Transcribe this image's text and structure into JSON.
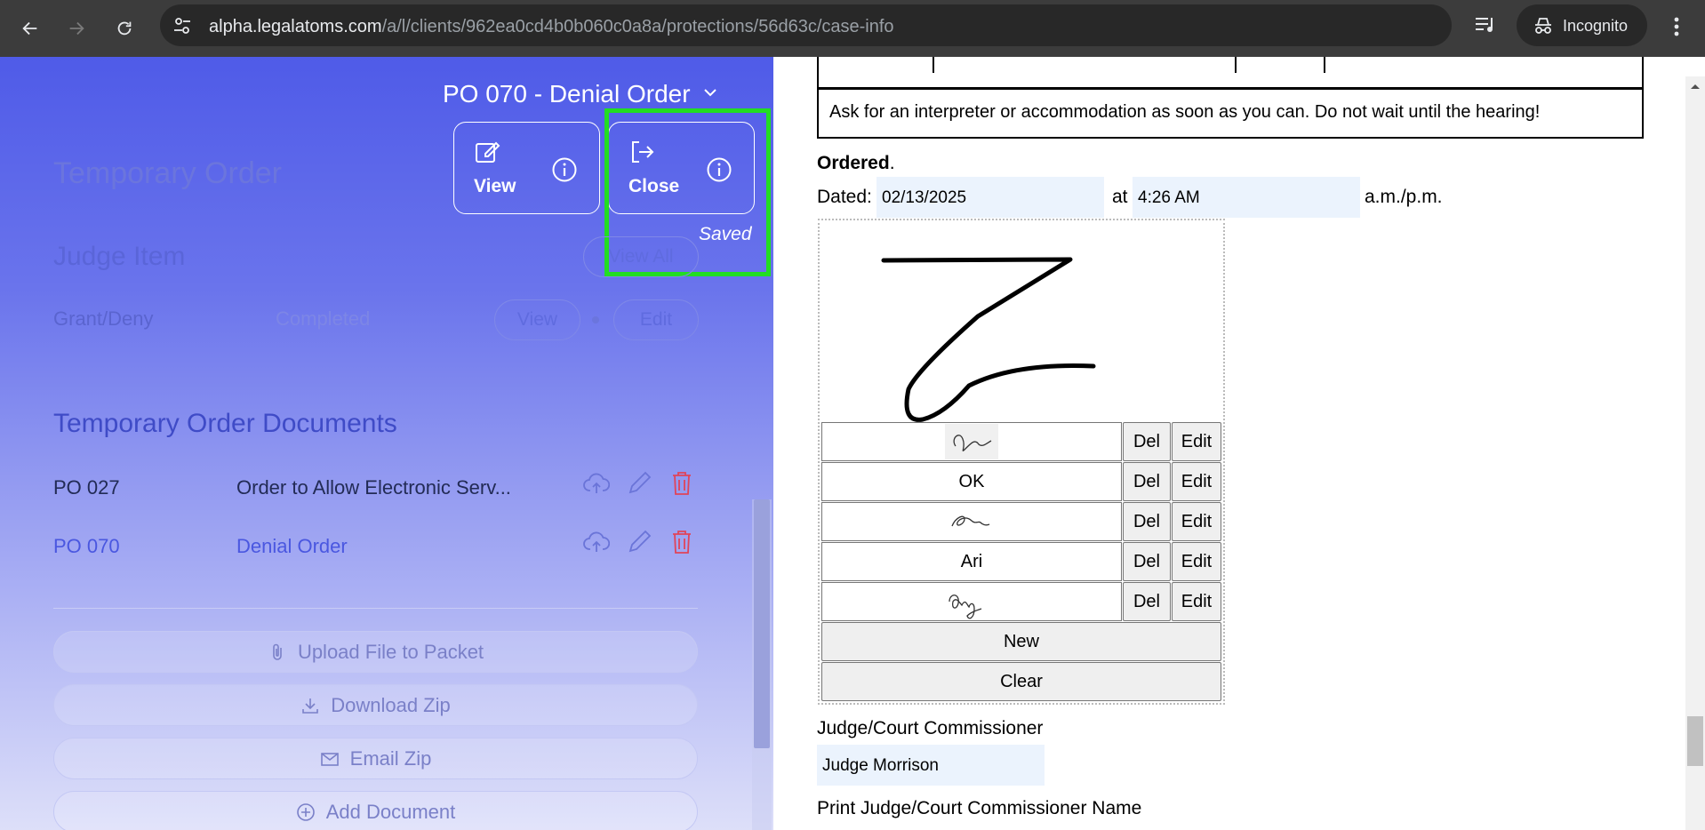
{
  "browser": {
    "url_host": "alpha.legalatoms.com",
    "url_path": "/a/l/clients/962ea0cd4b0b060c0a8a/protections/56d63c/case-info",
    "incognito_label": "Incognito"
  },
  "left_panel": {
    "background_title": "Temporary Order",
    "document_heading": "PO 070 - Denial Order",
    "actions": [
      {
        "label": "View",
        "icon": "edit-square-icon"
      },
      {
        "label": "Close",
        "icon": "exit-icon"
      }
    ],
    "saved_label": "Saved",
    "judge_section": {
      "title": "Judge Item",
      "view_all_label": "View All",
      "item_name": "Grant/Deny",
      "item_status": "Completed",
      "view_label": "View",
      "edit_label": "Edit"
    },
    "documents_section": {
      "title": "Temporary Order Documents",
      "rows": [
        {
          "code": "PO 027",
          "name": "Order to Allow Electronic Serv..."
        },
        {
          "code": "PO 070",
          "name": "Denial Order"
        }
      ]
    },
    "buttons": {
      "upload": "Upload File to Packet",
      "download": "Download Zip",
      "email": "Email Zip",
      "add": "Add Document"
    },
    "colors": {
      "accent": "#4f5be8",
      "highlight": "#22dd22",
      "delete": "#e0445a"
    }
  },
  "document": {
    "notice": "Ask for an interpreter or accommodation as soon as you can. Do not wait until the hearing!",
    "ordered_bold": "Ordered",
    "ordered_suffix": ".",
    "dated_label": "Dated:",
    "date_value": "02/13/2025",
    "at_label": "at",
    "time_value": "4:26 AM",
    "ampm_label": "a.m./p.m.",
    "signature_rows": [
      {
        "text": "",
        "kind": "signature-image",
        "del": "Del",
        "edit": "Edit"
      },
      {
        "text": "OK",
        "kind": "text",
        "del": "Del",
        "edit": "Edit"
      },
      {
        "text": "",
        "kind": "signature-image",
        "del": "Del",
        "edit": "Edit"
      },
      {
        "text": "Ari",
        "kind": "text",
        "del": "Del",
        "edit": "Edit"
      },
      {
        "text": "",
        "kind": "signature-image",
        "del": "Del",
        "edit": "Edit"
      }
    ],
    "new_label": "New",
    "clear_label": "Clear",
    "judge_label": "Judge/Court Commissioner",
    "judge_value": "Judge Morrison",
    "print_label": "Print Judge/Court Commissioner Name"
  }
}
